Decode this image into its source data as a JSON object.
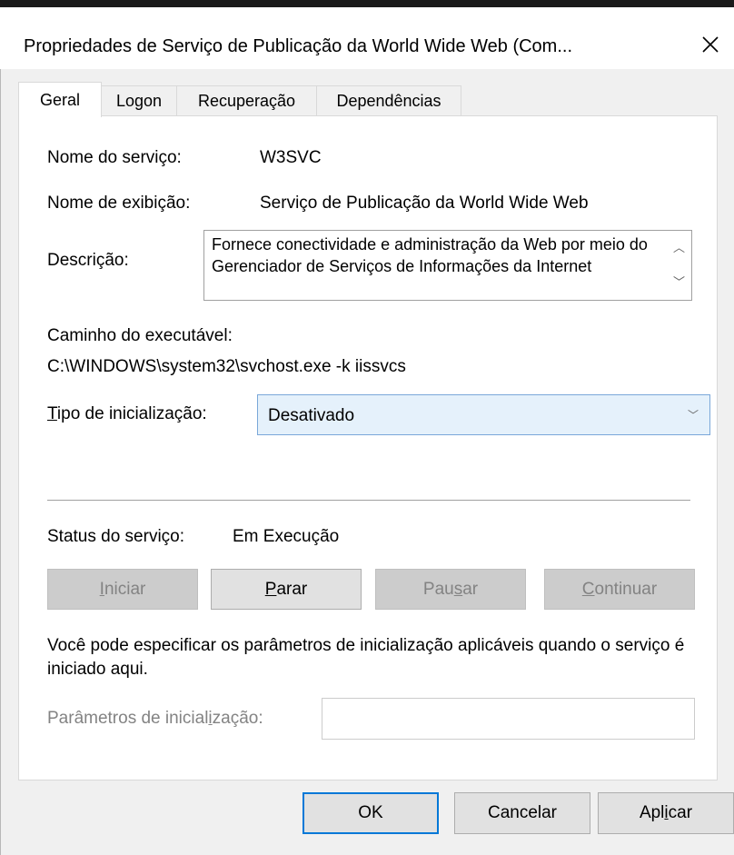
{
  "window": {
    "title": "Propriedades de Serviço de Publicação da World Wide Web (Com...",
    "close_icon": "close-icon"
  },
  "tabs": [
    {
      "label": "Geral",
      "active": true
    },
    {
      "label": "Logon",
      "active": false
    },
    {
      "label": "Recuperação",
      "active": false
    },
    {
      "label": "Dependências",
      "active": false
    }
  ],
  "general": {
    "service_name_label": "Nome do serviço:",
    "service_name_value": "W3SVC",
    "display_name_label": "Nome de exibição:",
    "display_name_value": "Serviço de Publicação da World Wide Web",
    "description_label": "Descrição:",
    "description_value": "Fornece conectividade e administração da Web por meio do Gerenciador de Serviços de Informações da Internet",
    "exe_path_label": "Caminho do executável:",
    "exe_path_value": "C:\\WINDOWS\\system32\\svchost.exe -k iissvcs",
    "startup_type_label_prefix": "T",
    "startup_type_label_rest": "ipo de inicialização:",
    "startup_type_value": "Desativado",
    "status_label": "Status do serviço:",
    "status_value": "Em Execução"
  },
  "buttons": {
    "start_u": "I",
    "start_rest": "niciar",
    "stop_u": "P",
    "stop_rest": "arar",
    "pause_pre": "Pau",
    "pause_u": "s",
    "pause_rest": "ar",
    "continue_u": "C",
    "continue_rest": "ontinuar"
  },
  "info_text": "Você pode especificar os parâmetros de inicialização aplicáveis quando o serviço é iniciado aqui.",
  "params": {
    "label_pre": "Parâmetros de inicial",
    "label_u": "i",
    "label_rest": "zação:",
    "value": ""
  },
  "footer": {
    "ok": "OK",
    "cancel": "Cancelar",
    "apply_pre": "Apl",
    "apply_u": "i",
    "apply_rest": "car"
  }
}
